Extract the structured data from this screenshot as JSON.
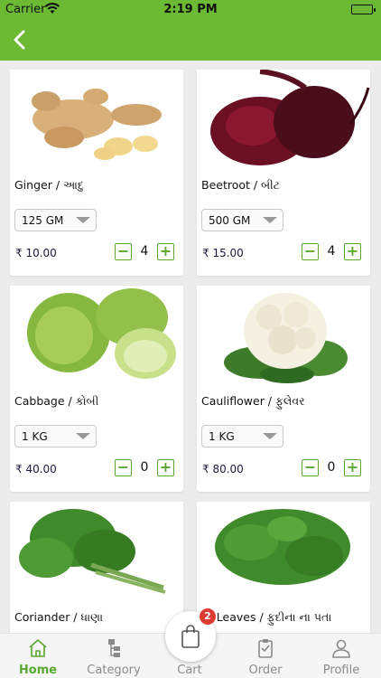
{
  "status_bar": {
    "carrier": "Carrier",
    "time": "2:19 PM"
  },
  "colors": {
    "brand_green": "#6cb934",
    "accent_green": "#5aa832",
    "badge_red": "#e03c31"
  },
  "products": [
    {
      "name": "Ginger / આદુ",
      "weight": "125 GM",
      "price": "₹ 10.00",
      "qty": "4"
    },
    {
      "name": "Beetroot / બીટ",
      "weight": "500 GM",
      "price": "₹ 15.00",
      "qty": "4"
    },
    {
      "name": "Cabbage / કોબી",
      "weight": "1 KG",
      "price": "₹ 40.00",
      "qty": "0"
    },
    {
      "name": "Cauliflower / ફુલેવર",
      "weight": "1 KG",
      "price": "₹ 80.00",
      "qty": "0"
    },
    {
      "name": "Coriander / ધાણા",
      "weight": "",
      "price": "",
      "qty": ""
    },
    {
      "name": "nt Leaves / ફુદીના ના પતા",
      "weight": "",
      "price": "",
      "qty": ""
    }
  ],
  "stepper": {
    "minus": "−",
    "plus": "+"
  },
  "tabbar": {
    "home": "Home",
    "category": "Category",
    "cart": "Cart",
    "order": "Order",
    "profile": "Profile",
    "active": "home"
  },
  "cart_badge": "2"
}
